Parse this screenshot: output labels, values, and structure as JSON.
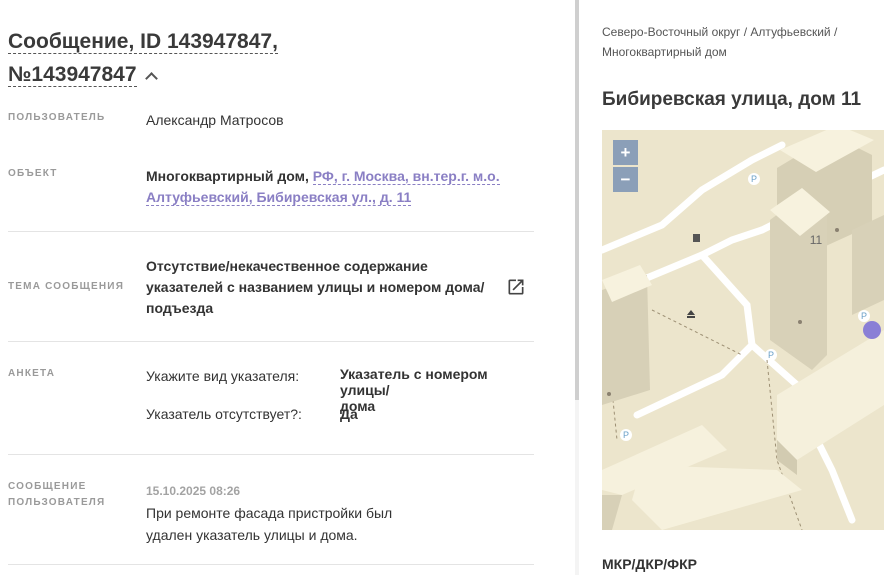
{
  "message": {
    "title_line1": "Сообщение, ID 143947847,",
    "title_line2": "№143947847"
  },
  "fields": {
    "user_label": "ПОЛЬЗОВАТЕЛЬ",
    "user_value": "Александр Матросов",
    "object_label": "ОБЪЕКТ",
    "object_type": "Многоквартирный дом,",
    "object_link_line1": "РФ, г. Москва, вн.тер.г. м.о.",
    "object_link_line2": "Алтуфьевский, Бибиревская ул., д. 11",
    "topic_label": "ТЕМА СООБЩЕНИЯ",
    "topic_line1": "Отсутствие/некачественное содержание",
    "topic_line2": "указателей с названием улицы и номером дома/",
    "topic_line3": "подъезда",
    "survey_label": "АНКЕТА",
    "survey_q1": "Укажите вид указателя:",
    "survey_a1_line1": "Указатель с номером улицы/",
    "survey_a1_line2": "дома",
    "survey_q2": "Указатель отсутствует?:",
    "survey_a2": "Да",
    "msg_label_line1": "СООБЩЕНИЕ",
    "msg_label_line2": "ПОЛЬЗОВАТЕЛЯ",
    "msg_date": "15.10.2025 08:26",
    "msg_line1": "При ремонте фасада пристройки был",
    "msg_line2": "удален указатель улицы и дома."
  },
  "right": {
    "breadcrumb_line1": "Северо-Восточный округ / Алтуфьевский /",
    "breadcrumb_line2": "Многоквартирный дом",
    "address": "Бибиревская улица, дом 11",
    "zoom_in": "+",
    "zoom_out": "−",
    "building_number": "11",
    "parking_label": "P",
    "section_title": "МКР/ДКР/ФКР"
  },
  "colors": {
    "link": "#8a7fc4",
    "map_bg": "#ece5cc",
    "marker": "#8a7fd6",
    "zoom_bg": "#8b9fb8"
  }
}
